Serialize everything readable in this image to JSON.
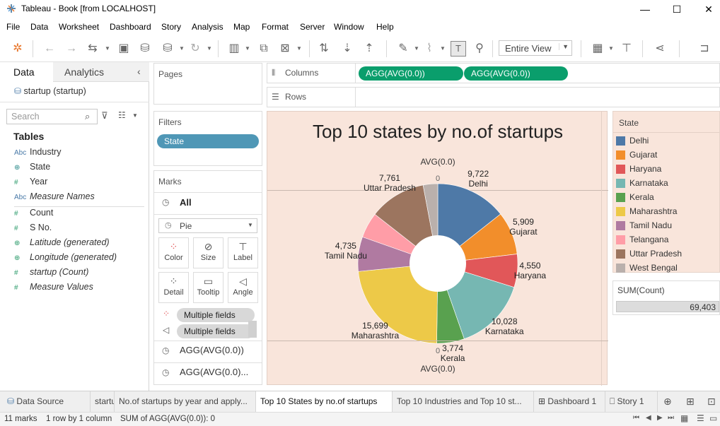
{
  "window": {
    "title": "Tableau - Book [from LOCALHOST]",
    "minimize": "—",
    "maximize": "☐",
    "close": "✕"
  },
  "menu": [
    "File",
    "Data",
    "Worksheet",
    "Dashboard",
    "Story",
    "Analysis",
    "Map",
    "Format",
    "Server",
    "Window",
    "Help"
  ],
  "toolbar": {
    "view_select": "Entire View",
    "icons": [
      "tableau-logo-icon",
      "back-icon",
      "forward-icon",
      "swap-icon",
      "save-icon",
      "new-datasource-icon",
      "pause-icon",
      "refresh-icon",
      "new-sheet-icon",
      "duplicate-icon",
      "clear-icon",
      "swap-axes-icon",
      "sort-asc-icon",
      "sort-desc-icon",
      "highlight-icon",
      "clip-icon",
      "text-label-icon",
      "pin-icon",
      "show-me-icon",
      "presentation-icon",
      "share-icon",
      "format-painter-icon"
    ]
  },
  "datapane": {
    "tab_data": "Data",
    "tab_analytics": "Analytics",
    "datasource": "startup (startup)",
    "search_placeholder": "Search",
    "tables_heading": "Tables",
    "dimensions": [
      {
        "type": "Abc",
        "name": "Industry"
      },
      {
        "type": "globe",
        "name": "State"
      },
      {
        "type": "#",
        "name": "Year"
      },
      {
        "type": "Abc",
        "name": "Measure Names"
      }
    ],
    "measures": [
      {
        "type": "#",
        "name": "Count"
      },
      {
        "type": "#",
        "name": "S No."
      },
      {
        "type": "globe",
        "name": "Latitude (generated)"
      },
      {
        "type": "globe",
        "name": "Longitude (generated)"
      },
      {
        "type": "#",
        "name": "startup (Count)"
      },
      {
        "type": "#",
        "name": "Measure Values"
      }
    ]
  },
  "shelves": {
    "pages": "Pages",
    "columns_label": "Columns",
    "rows_label": "Rows",
    "column_pills": [
      "AGG(AVG(0.0))",
      "AGG(AVG(0.0))"
    ],
    "filters": "Filters",
    "filter_pill": "State"
  },
  "marks": {
    "title": "Marks",
    "all": "All",
    "type": "Pie",
    "buttons": [
      "Color",
      "Size",
      "Label",
      "Detail",
      "Tooltip",
      "Angle"
    ],
    "field_pills": [
      "Multiple fields",
      "Multiple fields"
    ],
    "sections": [
      "AGG(AVG(0.0))",
      "AGG(AVG(0.0)..."
    ]
  },
  "viz": {
    "title": "Top 10 states by no.of startups",
    "axis_top_label": "AVG(0.0)",
    "axis_top_zero": "0",
    "axis_bottom_zero": "0",
    "axis_bottom_label": "AVG(0.0)"
  },
  "chart_data": {
    "type": "pie",
    "title": "Top 10 states by no.of startups",
    "donut": true,
    "slices": [
      {
        "label": "Delhi",
        "value": 9722,
        "value_label": "9,722",
        "color": "#4e79a7"
      },
      {
        "label": "Gujarat",
        "value": 5909,
        "value_label": "5,909",
        "color": "#f28e2b"
      },
      {
        "label": "Haryana",
        "value": 4550,
        "value_label": "4,550",
        "color": "#e15759"
      },
      {
        "label": "Karnataka",
        "value": 10028,
        "value_label": "10,028",
        "color": "#76b7b2"
      },
      {
        "label": "Kerala",
        "value": 3774,
        "value_label": "3,774",
        "color": "#59a14f"
      },
      {
        "label": "Maharashtra",
        "value": 15699,
        "value_label": "15,699",
        "color": "#edc948"
      },
      {
        "label": "Tamil Nadu",
        "value": 4735,
        "value_label": "4,735",
        "color": "#b07aa1"
      },
      {
        "label": "Telangana",
        "value": 3500,
        "value_label": "",
        "color": "#ff9da7"
      },
      {
        "label": "Uttar Pradesh",
        "value": 7761,
        "value_label": "7,761",
        "color": "#9c755f"
      },
      {
        "label": "West Bengal",
        "value": 2000,
        "value_label": "",
        "color": "#bab0ac"
      }
    ]
  },
  "legend": {
    "title": "State",
    "items": [
      {
        "name": "Delhi",
        "color": "#4e79a7"
      },
      {
        "name": "Gujarat",
        "color": "#f28e2b"
      },
      {
        "name": "Haryana",
        "color": "#e15759"
      },
      {
        "name": "Karnataka",
        "color": "#76b7b2"
      },
      {
        "name": "Kerala",
        "color": "#59a14f"
      },
      {
        "name": "Maharashtra",
        "color": "#edc948"
      },
      {
        "name": "Tamil Nadu",
        "color": "#b07aa1"
      },
      {
        "name": "Telangana",
        "color": "#ff9da7"
      },
      {
        "name": "Uttar Pradesh",
        "color": "#9c755f"
      },
      {
        "name": "West Bengal",
        "color": "#bab0ac"
      }
    ]
  },
  "size_legend": {
    "title": "SUM(Count)",
    "value": "69,403"
  },
  "tabs": {
    "data_source": "Data Source",
    "sheets": [
      "startu...",
      "No.of startups by year and apply...",
      "Top 10 States by no.of startups",
      "Top 10  Industries and Top 10 st...",
      "Dashboard 1",
      "Story 1"
    ]
  },
  "status": {
    "marks": "11 marks",
    "rows": "1 row by 1 column",
    "sum": "SUM of AGG(AVG(0.0)): 0"
  }
}
